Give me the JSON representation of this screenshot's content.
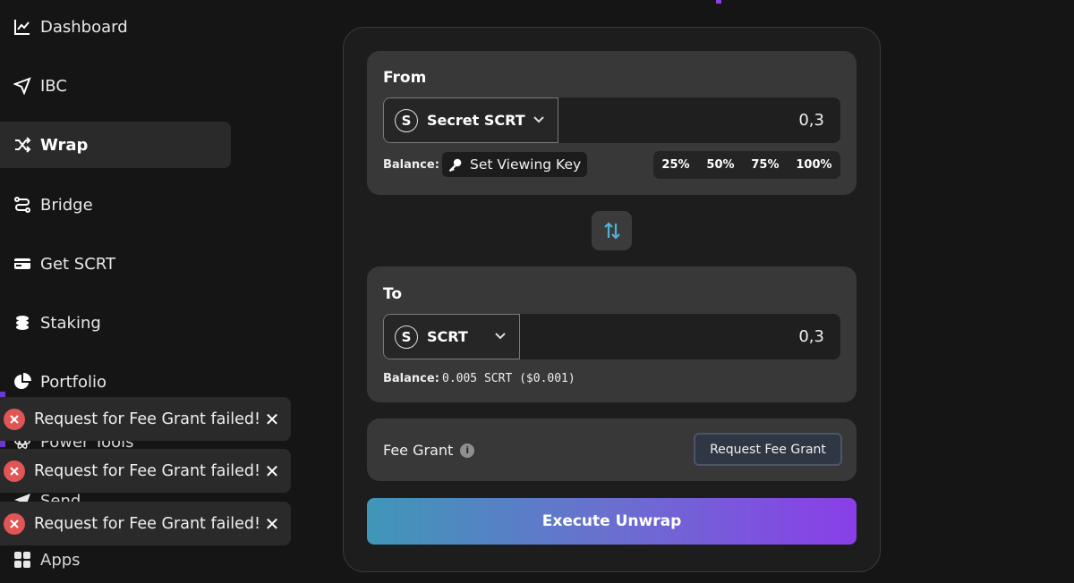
{
  "nav": {
    "items": [
      {
        "label": "Dashboard",
        "icon": "chart-line-icon"
      },
      {
        "label": "IBC",
        "icon": "send-arrow-icon"
      },
      {
        "label": "Wrap",
        "icon": "shuffle-icon",
        "active": true
      },
      {
        "label": "Bridge",
        "icon": "route-icon"
      },
      {
        "label": "Get SCRT",
        "icon": "credit-card-icon"
      },
      {
        "label": "Staking",
        "icon": "coins-icon"
      },
      {
        "label": "Portfolio",
        "icon": "pie-chart-icon"
      },
      {
        "label": "Power Tools",
        "icon": "atom-icon"
      },
      {
        "label": "Send",
        "icon": "paper-plane-icon"
      },
      {
        "label": "Apps",
        "icon": "grid-icon"
      }
    ]
  },
  "toasts": [
    {
      "message": "Request for Fee Grant failed!"
    },
    {
      "message": "Request for Fee Grant failed!"
    },
    {
      "message": "Request for Fee Grant failed!"
    }
  ],
  "from": {
    "title": "From",
    "token": "Secret SCRT",
    "token_icon": "S",
    "amount": "0,3",
    "balance_label": "Balance:",
    "set_viewing_key": "Set Viewing Key",
    "percents": [
      "25%",
      "50%",
      "75%",
      "100%"
    ]
  },
  "to": {
    "title": "To",
    "token": "SCRT",
    "token_icon": "S",
    "amount": "0,3",
    "balance_label": "Balance:",
    "balance_value": "0.005 SCRT ($0.001)"
  },
  "fee_grant": {
    "label": "Fee Grant",
    "info_glyph": "i",
    "button": "Request Fee Grant"
  },
  "execute": {
    "label": "Execute Unwrap"
  },
  "colors": {
    "accent_start": "#3f97b8",
    "accent_end": "#8a3ee8",
    "error": "#e15555",
    "swap_arrows": "#4fb3d9"
  }
}
